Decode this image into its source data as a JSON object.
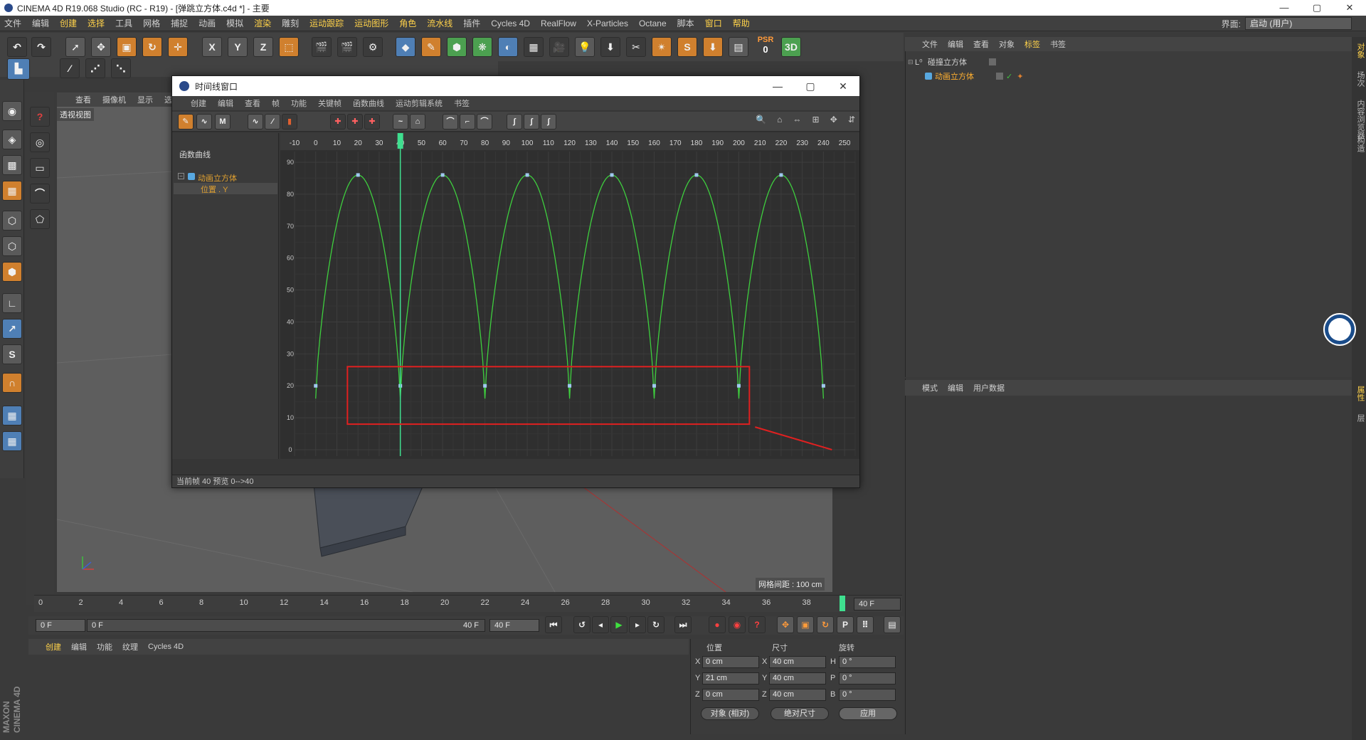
{
  "app": {
    "title": "CINEMA 4D R19.068 Studio (RC - R19) - [弹跳立方体.c4d *] - 主要",
    "window_controls": [
      "—",
      "▢",
      "✕"
    ]
  },
  "main_menu": {
    "items": [
      "文件",
      "编辑",
      "创建",
      "选择",
      "工具",
      "网格",
      "捕捉",
      "动画",
      "模拟",
      "渲染",
      "雕刻",
      "运动跟踪",
      "运动图形",
      "角色",
      "流水线",
      "插件",
      "Cycles 4D",
      "RealFlow",
      "X-Particles",
      "Octane",
      "脚本",
      "窗口",
      "帮助"
    ],
    "interface_label": "界面:",
    "interface_value": "启动 (用户)"
  },
  "toolbar": {
    "psr_label": "PSR",
    "psr_value": "0"
  },
  "viewport": {
    "menu": [
      "查看",
      "摄像机",
      "显示",
      "选项"
    ],
    "label": "透视视图",
    "grid_info": "网格间距 : 100 cm"
  },
  "timeline_window": {
    "title": "时间线窗口",
    "menu": [
      "创建",
      "编辑",
      "查看",
      "帧",
      "功能",
      "关键帧",
      "函数曲线",
      "运动剪辑系统",
      "书签"
    ],
    "left_header": "函数曲线",
    "tracks": [
      {
        "label": "动画立方体"
      },
      {
        "label": "位置 . Y"
      }
    ],
    "status": "当前帧  40  预览  0-->40",
    "ruler_ticks": [
      "-10",
      "0",
      "10",
      "20",
      "30",
      "40",
      "50",
      "60",
      "70",
      "80",
      "90",
      "100",
      "110",
      "120",
      "130",
      "140",
      "150",
      "160",
      "170",
      "180",
      "190",
      "200",
      "210",
      "220",
      "230",
      "240",
      "250"
    ],
    "y_ticks": [
      "0",
      "10",
      "20",
      "30",
      "40",
      "50",
      "60",
      "70",
      "80",
      "90"
    ],
    "current_frame": 40,
    "curve_color": "#3ecf3e",
    "highlight_color": "#e02020"
  },
  "object_manager": {
    "menu": [
      "文件",
      "编辑",
      "查看",
      "对象",
      "标签",
      "书签"
    ],
    "objects": [
      {
        "name": "碰撞立方体"
      },
      {
        "name": "动画立方体"
      }
    ]
  },
  "attribute_manager": {
    "menu": [
      "模式",
      "编辑",
      "用户数据"
    ]
  },
  "right_tabs": [
    "对象",
    "场次",
    "内容浏览器",
    "构造",
    "属性",
    "层"
  ],
  "bottom_timeline": {
    "ticks": [
      "0",
      "2",
      "4",
      "6",
      "8",
      "10",
      "12",
      "14",
      "16",
      "18",
      "20",
      "22",
      "24",
      "26",
      "28",
      "30",
      "32",
      "34",
      "36",
      "38"
    ],
    "frame_field": "40 F"
  },
  "transport": {
    "start": "0 F",
    "range_start": "0 F",
    "range_end": "40 F",
    "end": "40 F"
  },
  "material_manager": {
    "menu": [
      "创建",
      "编辑",
      "功能",
      "纹理",
      "Cycles 4D"
    ],
    "brand": "MAXON CINEMA 4D"
  },
  "coordinates": {
    "headers": [
      "位置",
      "尺寸",
      "旋转"
    ],
    "rows": [
      {
        "axis_pos": "X",
        "pos": "0 cm",
        "axis_size": "X",
        "size": "40 cm",
        "axis_rot": "H",
        "rot": "0 °"
      },
      {
        "axis_pos": "Y",
        "pos": "21 cm",
        "axis_size": "Y",
        "size": "40 cm",
        "axis_rot": "P",
        "rot": "0 °"
      },
      {
        "axis_pos": "Z",
        "pos": "0 cm",
        "axis_size": "Z",
        "size": "40 cm",
        "axis_rot": "B",
        "rot": "0 °"
      }
    ],
    "mode_dropdown": "对象 (相对)",
    "size_dropdown": "绝对尺寸",
    "apply_button": "应用"
  }
}
